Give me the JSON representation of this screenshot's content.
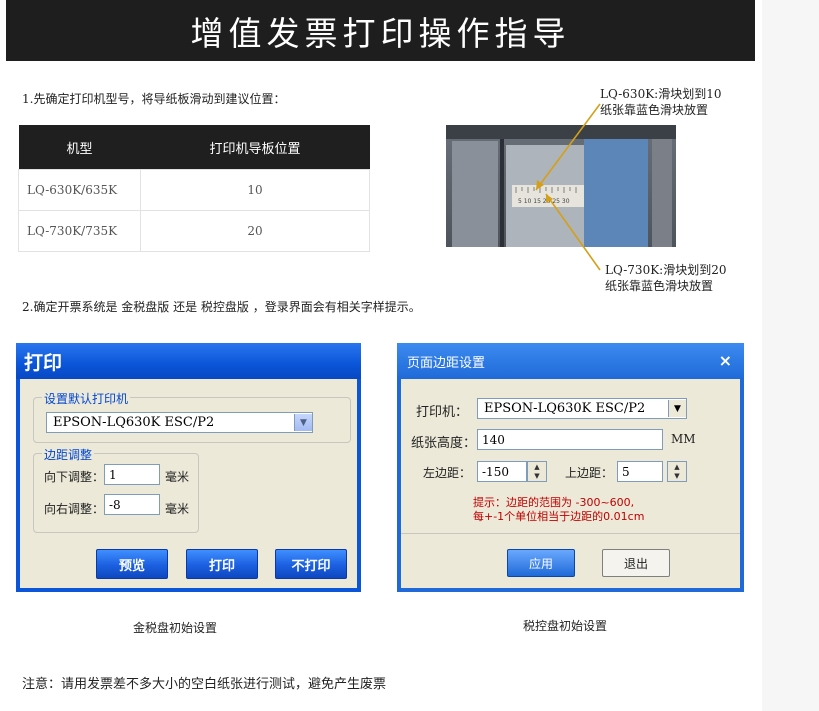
{
  "banner_title": "增值发票打印操作指导",
  "step1": "1.先确定打印机型号，将导纸板滑动到建议位置：",
  "table": {
    "headers": [
      "机型",
      "打印机导板位置"
    ],
    "rows": [
      {
        "model": "LQ-630K/635K",
        "position": "10"
      },
      {
        "model": "LQ-730K/735K",
        "position": "20"
      }
    ]
  },
  "photo": {
    "ruler_text": "5 10 15 20 25 30"
  },
  "callouts": {
    "top": [
      "LQ-630K:滑块划到10",
      "纸张靠蓝色滑块放置"
    ],
    "bottom": [
      "LQ-730K:滑块划到20",
      "纸张靠蓝色滑块放置"
    ]
  },
  "step2": "2.确定开票系统是 金税盘版 还是 税控盘版 ，登录界面会有相关字样提示。",
  "dialog_print": {
    "title": "打印",
    "group_printer": "设置默认打印机",
    "printer_value": "EPSON-LQ630K ESC/P2",
    "group_margin": "边距调整",
    "down_label": "向下调整：",
    "down_value": "1",
    "down_unit": "毫米",
    "right_label": "向右调整：",
    "right_value": "-8",
    "right_unit": "毫米",
    "btn_preview": "预览",
    "btn_print": "打印",
    "btn_noprint": "不打印"
  },
  "dialog_margin": {
    "title": "页面边距设置",
    "close": "×",
    "printer_label": "打印机：",
    "printer_value": "EPSON-LQ630K ESC/P2",
    "height_label": "纸张高度：",
    "height_value": "140",
    "height_unit": "MM",
    "left_label": "左边距：",
    "left_value": "-150",
    "top_label": "上边距：",
    "top_value": "5",
    "hint1": "提示：边距的范围为 -300~600,",
    "hint2": "每+-1个单位相当于边距的0.01cm",
    "btn_apply": "应用",
    "btn_exit": "退出"
  },
  "captions": {
    "left": "金税盘初始设置",
    "right": "税控盘初始设置"
  },
  "note": "注意：请用发票差不多大小的空白纸张进行测试，避免产生废票",
  "colors": {
    "banner_bg": "#1e1e1e",
    "xp_blue": "#0a55d8",
    "hint_red": "#c00000",
    "callout_arrow": "#d4a017"
  }
}
